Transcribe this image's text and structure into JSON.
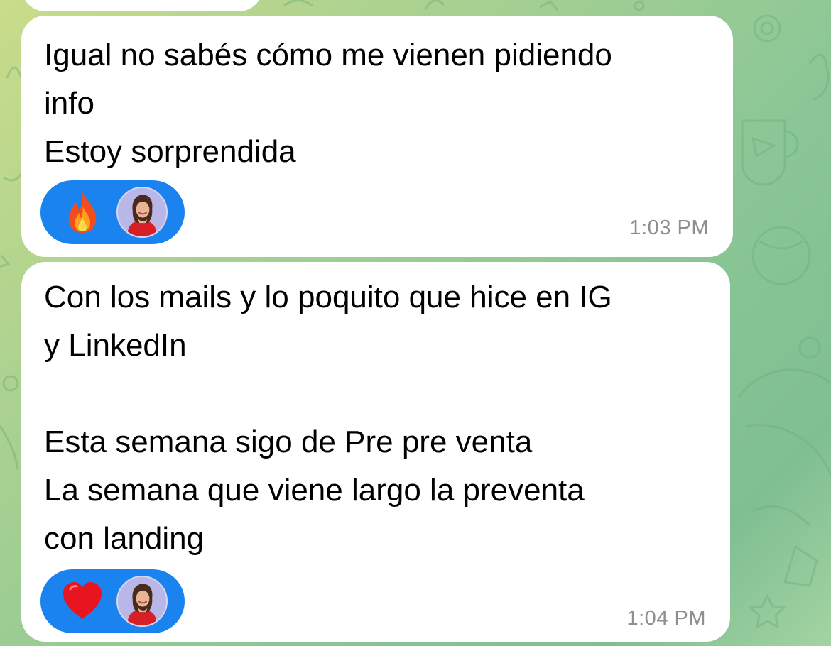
{
  "wallpaper": {
    "colors": [
      "#c9dc8a",
      "#8cc796",
      "#7fbf92"
    ],
    "pattern": "doodle-icons"
  },
  "messages": [
    {
      "text": "Igual no sabés cómo me vienen pidiendo\ninfo\nEstoy sorprendida",
      "time": "1:03 PM",
      "reaction": {
        "emoji": "fire-icon",
        "reactor": "avatar"
      }
    },
    {
      "text": "Con los mails y lo poquito que hice en IG\ny LinkedIn\n\nEsta semana sigo de Pre pre venta\nLa semana que viene largo la preventa\ncon landing",
      "time": "1:04 PM",
      "reaction": {
        "emoji": "heart-icon",
        "reactor": "avatar"
      }
    }
  ],
  "colors": {
    "bubble": "#ffffff",
    "reaction_pill": "#1a83f0",
    "timestamp": "#8e8e93",
    "text": "#000000"
  }
}
